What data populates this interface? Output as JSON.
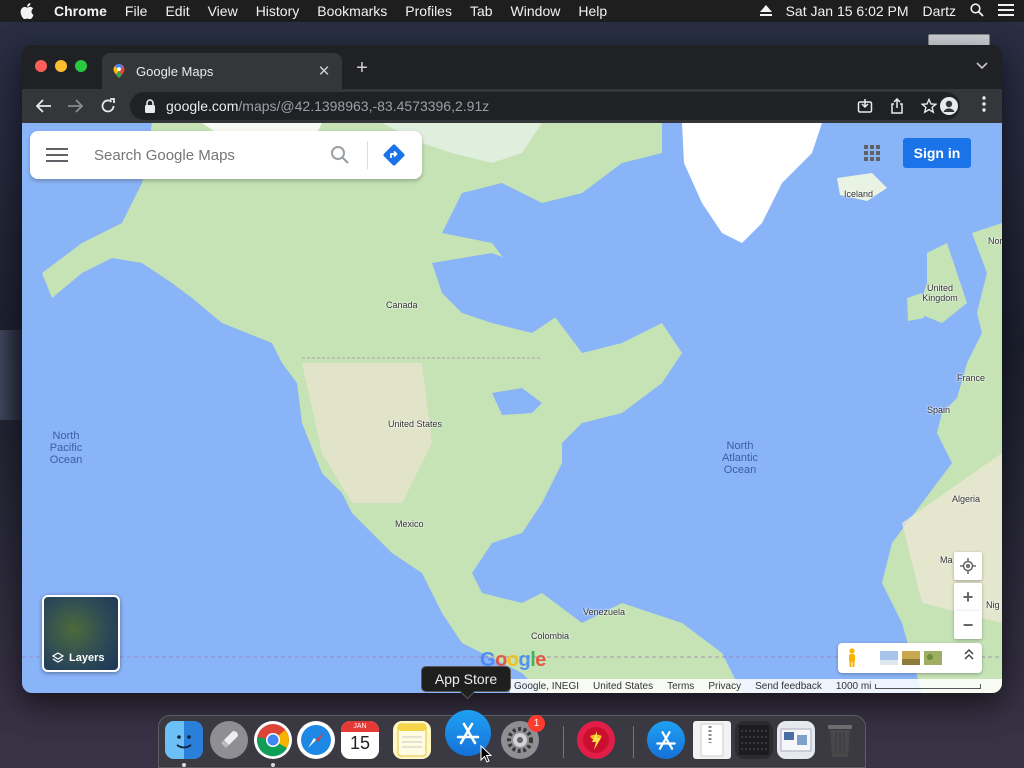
{
  "menubar": {
    "app_name": "Chrome",
    "items": [
      "File",
      "Edit",
      "View",
      "History",
      "Bookmarks",
      "Profiles",
      "Tab",
      "Window",
      "Help"
    ],
    "clock": "Sat Jan 15  6:02 PM",
    "user": "Dartz"
  },
  "browser": {
    "tab_title": "Google Maps",
    "url_host": "google.com",
    "url_path": "/maps/@42.1398963,-83.4573396,2.91z"
  },
  "maps": {
    "search_placeholder": "Search Google Maps",
    "signin_label": "Sign in",
    "layers_label": "Layers",
    "places": {
      "canada": "Canada",
      "usa": "United States",
      "mexico": "Mexico",
      "venezuela": "Venezuela",
      "colombia": "Colombia",
      "iceland": "Iceland",
      "uk": "United Kingdom",
      "france": "France",
      "spain": "Spain",
      "algeria": "Algeria",
      "ma": "Ma",
      "nor": "Nor",
      "nig": "Nig"
    },
    "oceans": {
      "north_pacific": "North Pacific Ocean",
      "north_atlantic": "North Atlantic Ocean"
    },
    "logo_text": "Google",
    "footer": {
      "attribution": "Google, INEGI",
      "country": "United States",
      "terms": "Terms",
      "privacy": "Privacy",
      "feedback": "Send feedback",
      "scale": "1000 mi"
    }
  },
  "dock": {
    "tooltip": "App Store",
    "calendar_month": "JAN",
    "calendar_day": "15",
    "settings_badge": "1"
  },
  "colors": {
    "water": "#8ab4f8",
    "land": "#c5e3b5",
    "ice": "#ffffff",
    "accent": "#1a73e8"
  }
}
